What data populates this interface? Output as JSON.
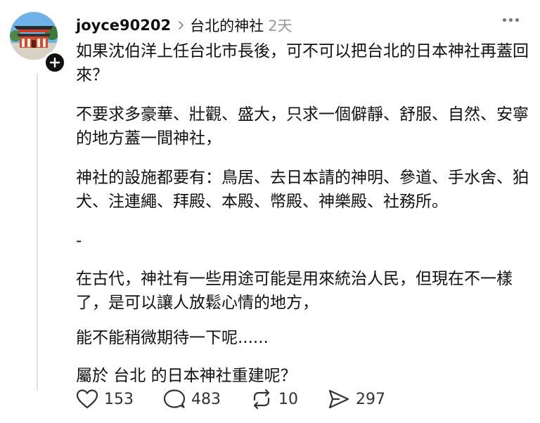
{
  "post": {
    "username": "joyce90202",
    "tag": "台北的神社",
    "time": "2天",
    "paragraphs": [
      "如果沈伯洋上任台北市長後，可不可以把台北的日本神社再蓋回來？",
      "不要求多豪華、壯觀、盛大，只求一個僻靜、舒服、自然、安寧的地方蓋一間神社，",
      "神社的設施都要有：鳥居、去日本請的神明、參道、手水舍、狛犬、注連繩、拜殿、本殿、幣殿、神樂殿、社務所。",
      "-",
      "在古代，神社有一些用途可能是用來統治人民，但現在不一樣了，是可以讓人放鬆心情的地方，",
      "能不能稍微期待一下呢......",
      "屬於 台北 的日本神社重建呢？"
    ]
  },
  "actions": {
    "likes": "153",
    "comments": "483",
    "reposts": "10",
    "shares": "297"
  },
  "icons": {
    "avatar": "torii-shrine-photo-icon",
    "follow": "plus-icon",
    "chevron": "chevron-right-icon",
    "more": "more-horizontal-icon",
    "like": "heart-icon",
    "comment": "comment-icon",
    "repost": "repost-icon",
    "share": "send-icon"
  }
}
